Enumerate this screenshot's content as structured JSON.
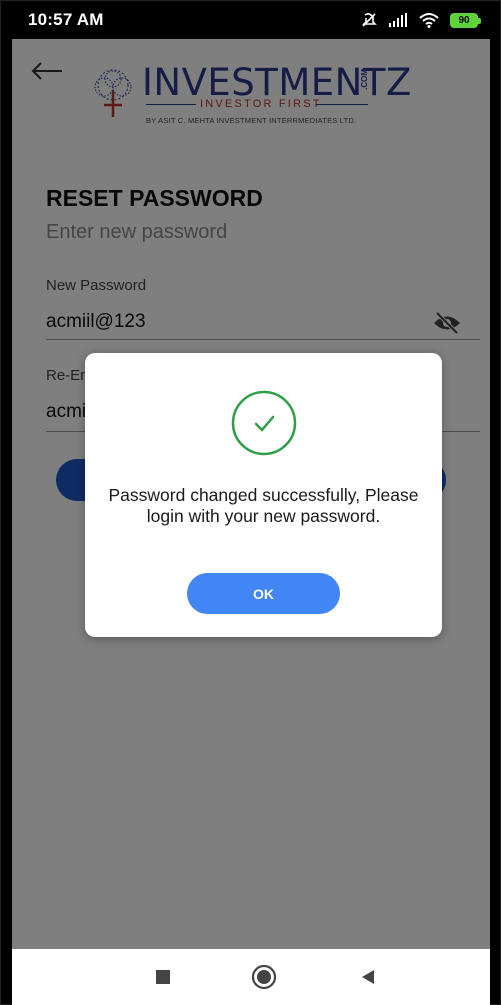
{
  "status_bar": {
    "time": "10:57 AM",
    "battery": "90"
  },
  "header": {
    "back_icon": "arrow-left-icon",
    "logo": {
      "name": "INVESTMENTZ",
      "com": ".COM",
      "tagline": "INVESTOR FIRST",
      "subtitle": "BY ASIT C. MEHTA INVESTMENT INTERRMEDIATES LTD."
    }
  },
  "form": {
    "title": "RESET PASSWORD",
    "subtitle": "Enter new password",
    "new_password": {
      "label": "New Password",
      "value": "acmiil@123",
      "toggle_icon": "eye-off-icon"
    },
    "reenter_password": {
      "label": "Re-Enter Password",
      "value": "acmiil@123"
    }
  },
  "dialog": {
    "icon": "check-circle-icon",
    "message": "Password changed successfully, Please login with your new password.",
    "ok_label": "OK"
  },
  "colors": {
    "accent": "#4285f4",
    "submit": "#1f56c9",
    "success": "#2e9e4a",
    "logo_blue": "#2a3a8c",
    "logo_red": "#c0312b"
  },
  "navbar": {
    "items": [
      "recents-square-icon",
      "home-circle-icon",
      "back-triangle-icon"
    ]
  }
}
